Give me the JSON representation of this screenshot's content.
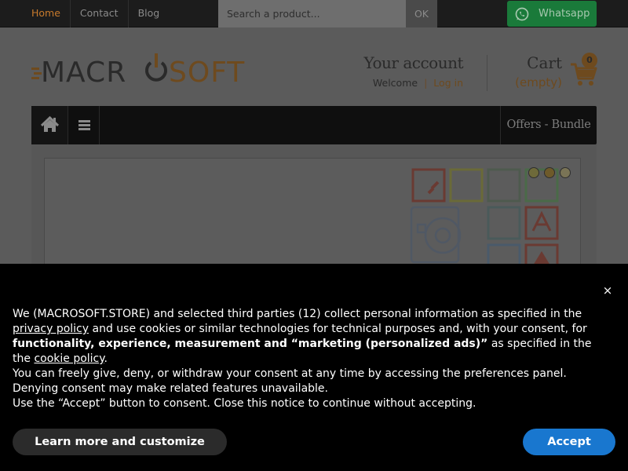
{
  "topbar": {
    "nav": [
      {
        "label": "Home",
        "active": true
      },
      {
        "label": "Contact",
        "active": false
      },
      {
        "label": "Blog",
        "active": false
      }
    ],
    "search_placeholder": "Search a product...",
    "search_button": "OK",
    "whatsapp_label": "Whatsapp"
  },
  "header": {
    "logo_left": "MACR",
    "logo_right": "SOFT",
    "account_title": "Your account",
    "welcome": "Welcome",
    "separator": "|",
    "login": "Log in",
    "cart_title": "Cart",
    "cart_status": "(empty)",
    "cart_count": "0"
  },
  "mainnav": {
    "offers_label": "Offers - Bundle"
  },
  "cookie": {
    "close_symbol": "×",
    "line1_a": "We (MACROSOFT.STORE) and selected third parties (12) collect personal information as specified in the",
    "privacy_link": "privacy policy",
    "line1_b": " and use cookies or similar technologies for technical purposes and, with your consent, for",
    "bold_text": "functionality, experience, measurement and “marketing (personalized ads)”",
    "line2_b": " as specified in the ",
    "cookie_link": "cookie policy",
    "line2_end": ".",
    "line3": "You can freely give, deny, or withdraw your consent at any time by accessing the preferences panel.",
    "line4": "Denying consent may make related features unavailable.",
    "line5": "Use the “Accept” button to consent. Close this notice to continue without accepting.",
    "learn_button": "Learn more and customize",
    "accept_button": "Accept"
  },
  "colors": {
    "accent_orange": "#c77a2c",
    "whatsapp_green": "#1a7a3a",
    "accept_blue": "#1977cf"
  }
}
